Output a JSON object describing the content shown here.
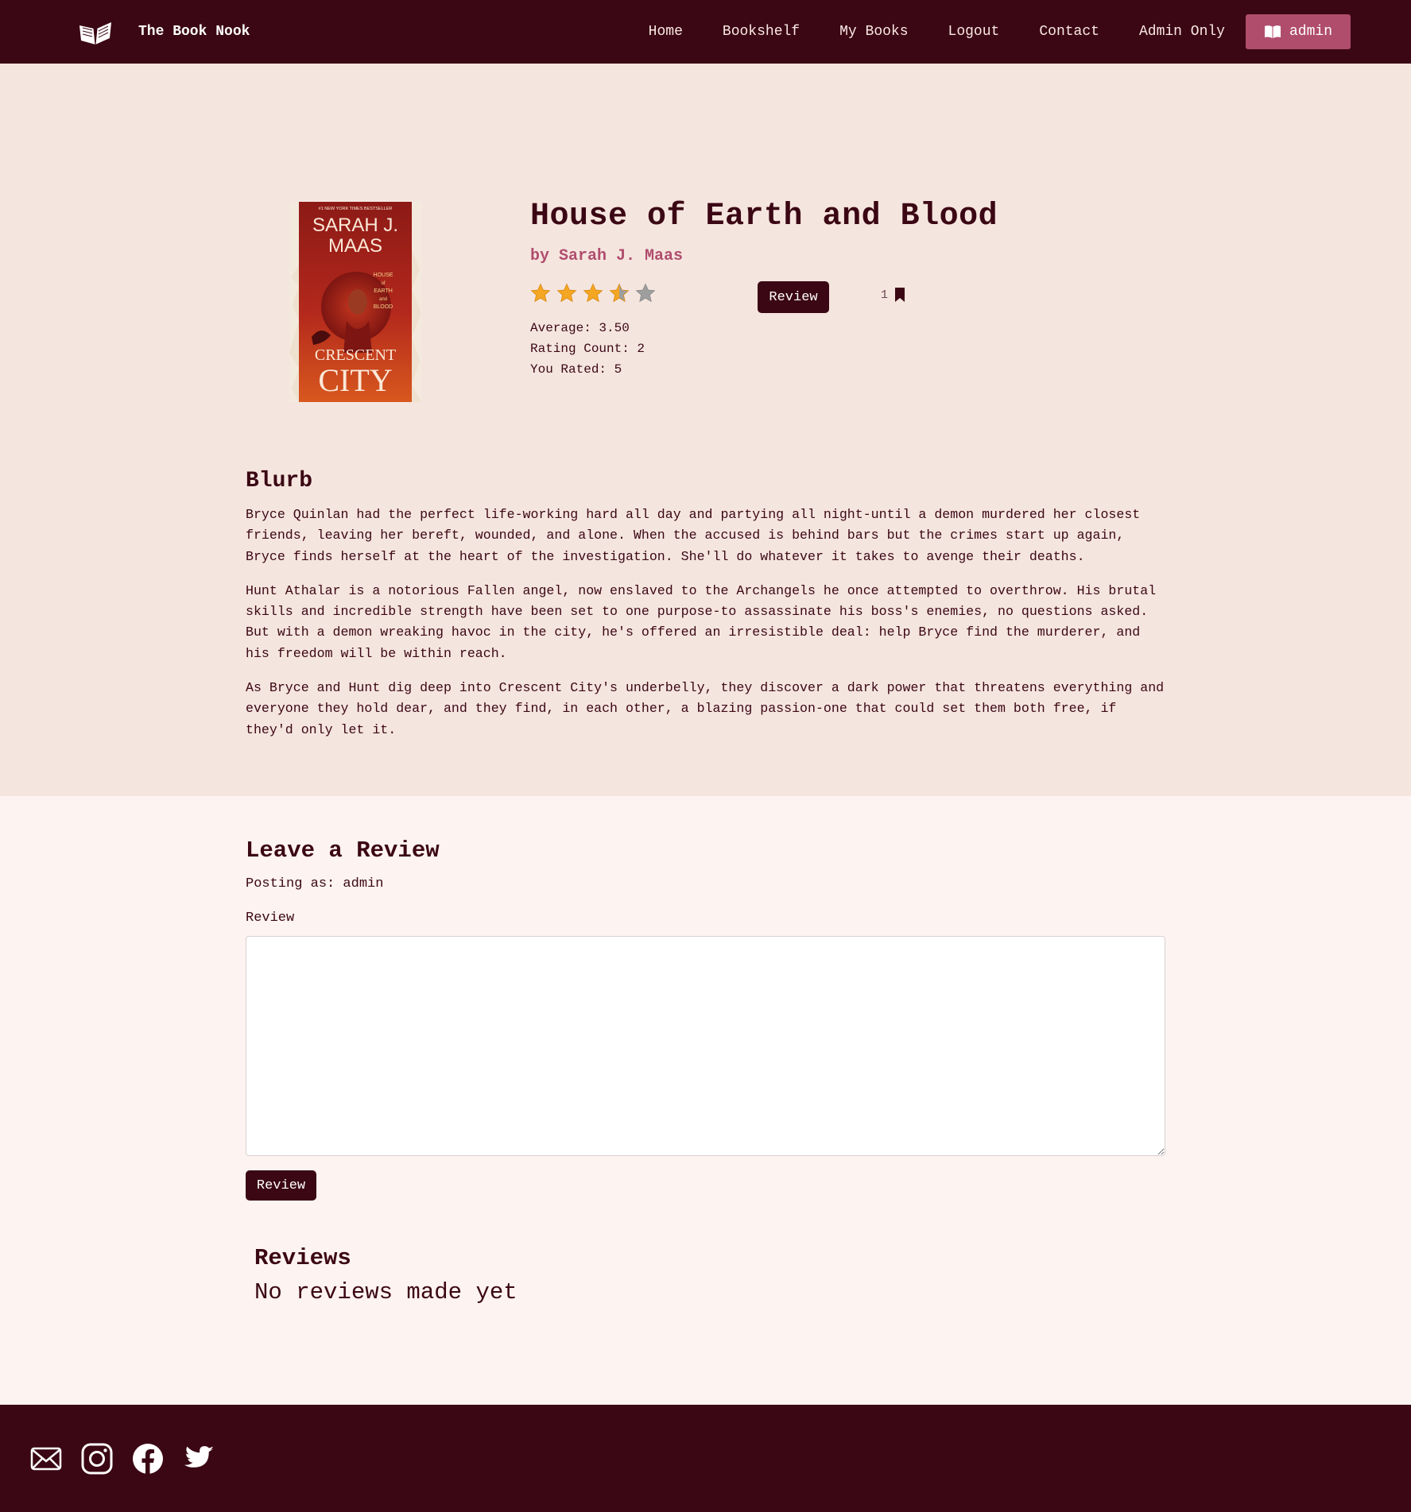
{
  "navbar": {
    "brand_name": "The Book Nook",
    "links": [
      "Home",
      "Bookshelf",
      "My Books",
      "Logout",
      "Contact",
      "Admin Only"
    ],
    "user_label": "admin"
  },
  "book": {
    "title": "House of Earth and Blood",
    "author_line": "by Sarah J. Maas",
    "cover": {
      "top_text": "#1 NEW YORK TIMES BESTSELLER",
      "author": [
        "SARAH J.",
        "MAAS"
      ],
      "small_title": [
        "HOUSE",
        "of",
        "EARTH",
        "and",
        "BLOOD"
      ],
      "series": [
        "CRESCENT",
        "CITY"
      ]
    },
    "rating": 3.5,
    "max_rating": 5,
    "review_button": "Review",
    "bookmark_count": "1",
    "average_text": "Average: 3.50",
    "rating_count_text": "Rating Count: 2",
    "you_rated_text": "You Rated: 5"
  },
  "blurb": {
    "heading": "Blurb",
    "paragraphs": [
      "Bryce Quinlan had the perfect life-working hard all day and partying all night-until a demon murdered her closest friends, leaving her bereft, wounded, and alone. When the accused is behind bars but the crimes start up again, Bryce finds herself at the heart of the investigation. She'll do whatever it takes to avenge their deaths.",
      "Hunt Athalar is a notorious Fallen angel, now enslaved to the Archangels he once attempted to overthrow. His brutal skills and incredible strength have been set to one purpose-to assassinate his boss's enemies, no questions asked. But with a demon wreaking havoc in the city, he's offered an irresistible deal: help Bryce find the murderer, and his freedom will be within reach.",
      "As Bryce and Hunt dig deep into Crescent City's underbelly, they discover a dark power that threatens everything and everyone they hold dear, and they find, in each other, a blazing passion-one that could set them both free, if they'd only let it."
    ]
  },
  "review_form": {
    "heading": "Leave a Review",
    "posting_as": "Posting as: admin",
    "field_label": "Review",
    "textarea_value": "",
    "submit_label": "Review"
  },
  "reviews": {
    "heading": "Reviews",
    "empty_text": "No reviews made yet"
  },
  "footer": {
    "icons": [
      "mail-icon",
      "instagram-icon",
      "facebook-icon",
      "twitter-icon"
    ]
  },
  "colors": {
    "primary": "#3b0714",
    "accent": "#b04d6d",
    "star_filled": "#f5a623",
    "star_empty": "#9e9e9e"
  }
}
